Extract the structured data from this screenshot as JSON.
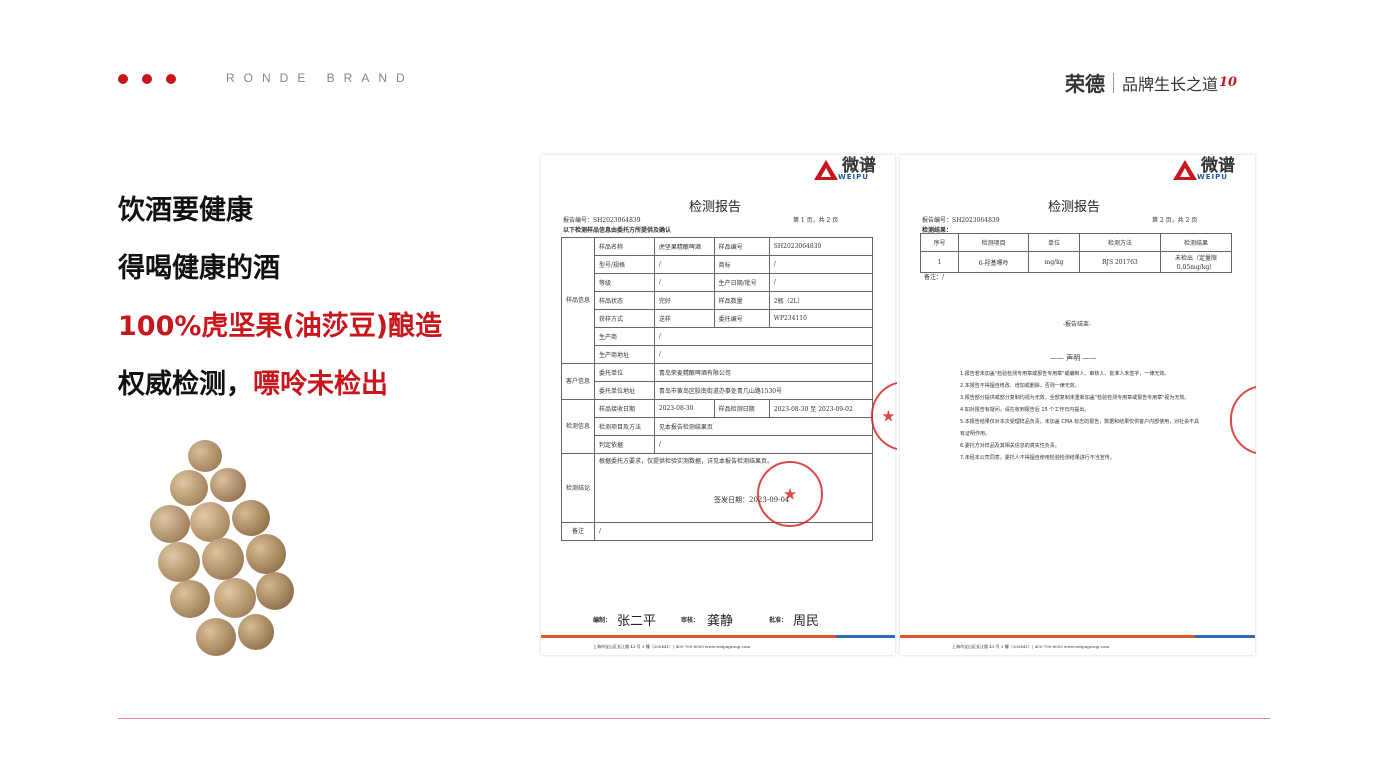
{
  "header": {
    "brand_en": "RONDE BRAND",
    "logo_name": "荣德",
    "slogan": "品牌生长之道",
    "anniversary": "10",
    "dot_color": "#c8161d"
  },
  "headlines": {
    "line1": "饮酒要健康",
    "line2": "得喝健康的酒",
    "line3": "100%虎坚果(油莎豆)酿造",
    "line4_a": "权威检测，",
    "line4_b": "嘌呤未检出"
  },
  "doc1": {
    "logo_cn": "微谱",
    "logo_en": "WEIPU",
    "title": "检测报告",
    "report_no": "报告编号：SH2023064839",
    "page": "第 1 页，共 2 页",
    "note": "以下检测样品信息由委托方所提供及确认",
    "sections": {
      "sample": "样品信息",
      "client": "客户信息",
      "test": "检测信息",
      "conclusion": "检测结论",
      "remark": "备注"
    },
    "rows": [
      [
        "样品名称",
        "虎坚果精酿啤酒",
        "样品编号",
        "SH2023064839"
      ],
      [
        "型号/规格",
        "/",
        "商标",
        "/"
      ],
      [
        "等级",
        "/",
        "生产日期/批号",
        "/"
      ],
      [
        "样品状态",
        "完好",
        "样品数量",
        "2瓶（2L）"
      ],
      [
        "获样方式",
        "送样",
        "委托编号",
        "WP234110"
      ]
    ],
    "producer_label": "生产商",
    "producer_value": "/",
    "producer_addr_label": "生产商地址",
    "producer_addr_value": "/",
    "client_label": "委托单位",
    "client_value": "青岛荣麦精酿啤酒有限公司",
    "client_addr_label": "委托单位地址",
    "client_addr_value": "青岛市黄岛区胶南街道办事处青几山路1530号",
    "received_label": "样品接收日期",
    "received_value": "2023-08-30",
    "test_date_label": "样品检测日期",
    "test_date_value": "2023-08-30 至 2023-09-02",
    "method_label": "检测项目及方法",
    "method_value": "见本报告检测结果页",
    "judge_label": "判定依据",
    "judge_value": "/",
    "conclusion_text": "根据委托方要求，仅提供检验实测数据，详见本报告检测结果页。",
    "issue_date": "签发日期：2023-09-04",
    "remark_value": "/",
    "sig_edit_label": "编制：",
    "sig_edit": "张二平",
    "sig_review_label": "审核：",
    "sig_review": "龚静",
    "sig_approve_label": "批准：",
    "sig_approve": "周民",
    "footer": "上海市宝山区长江路 43 号 3 幢（200441）| 400-700-6005 www.weipugroup.com"
  },
  "doc2": {
    "logo_cn": "微谱",
    "logo_en": "WEIPU",
    "title": "检测报告",
    "report_no": "报告编号：SH2023064839",
    "page": "第 2 页，共 2 页",
    "results_label": "检测结果：",
    "headers": [
      "序号",
      "检测项目",
      "单位",
      "检测方法",
      "检测结果"
    ],
    "row": [
      "1",
      "6-羟基嘌呤",
      "mg/kg",
      "RJS 201763",
      "未检出（定量限0.05mg/kg）"
    ],
    "remark": "备注：/",
    "end": "-报告结束-",
    "declaration_title": "—— 声明 ——",
    "declarations": [
      "1.报告若未加盖\"检验检测专用章或报告专用章\"或编制人、审核人、批准人未签字，一律无效。",
      "2.本报告不得擅自修改、增加或删除，否则一律无效。",
      "3.报告部分提供或部分复制均视为无效，全部复制未重新加盖\"检验检测专用章或报告专用章\"视为无效。",
      "4.如对报告有疑问，请在收到报告后 15 个工作日内提出。",
      "5.本报告结果仅对本次受理样品负责。未加盖 CMA 标志的报告，数据和结果仅供客户内部使用，对社会不具有证明作用。",
      "6.委托方对样品及其相关信息的真实性负责。",
      "7.未经本公司同意，委托人不得擅自使用检验检测结果进行不当宣传。"
    ],
    "footer": "上海市宝山区长江路 43 号 3 幢（200441）| 400-700-6005 www.weipugroup.com"
  }
}
